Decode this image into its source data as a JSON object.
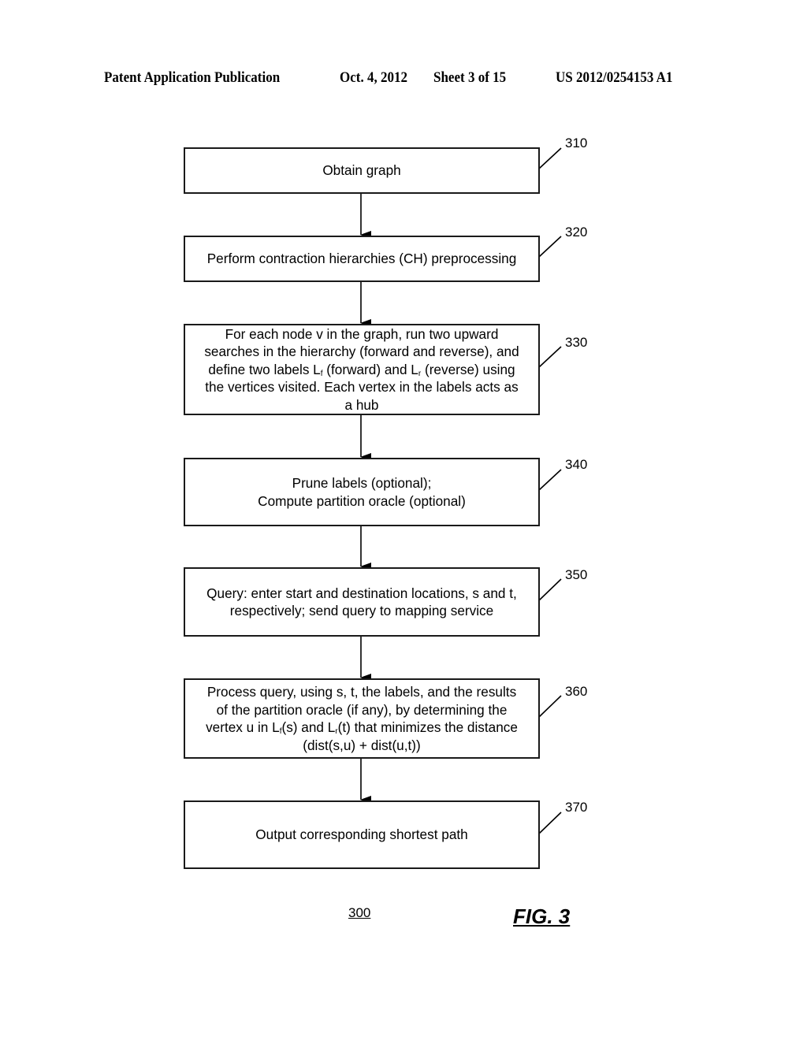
{
  "header": {
    "publication": "Patent Application Publication",
    "date": "Oct. 4, 2012",
    "sheet": "Sheet 3 of 15",
    "number": "US 2012/0254153 A1"
  },
  "flowchart": {
    "steps": [
      {
        "ref": "310",
        "text": "Obtain graph"
      },
      {
        "ref": "320",
        "text": "Perform contraction hierarchies (CH) preprocessing"
      },
      {
        "ref": "330",
        "line1": "For each node v in the graph, run two upward",
        "line2": "searches in the hierarchy (forward and reverse), and",
        "line3_a": "define two labels L",
        "line3_sub1": "f",
        "line3_b": " (forward) and L",
        "line3_sub2": "r",
        "line3_c": " (reverse) using",
        "line4": "the vertices visited.  Each vertex in the labels acts as",
        "line5": "a hub"
      },
      {
        "ref": "340",
        "line1": "Prune labels (optional);",
        "line2": "Compute partition oracle (optional)"
      },
      {
        "ref": "350",
        "line1": "Query: enter start and destination locations, s and t,",
        "line2": "respectively; send query to mapping service"
      },
      {
        "ref": "360",
        "line1": "Process query, using s, t, the labels, and the results",
        "line2": "of the partition oracle (if any), by determining the",
        "line3_a": "vertex u in L",
        "line3_sub1": "f",
        "line3_b": "(s) and L",
        "line3_sub2": "r",
        "line3_c": "(t) that minimizes the distance",
        "line4": "(dist(s,u) + dist(u,t))"
      },
      {
        "ref": "370",
        "text": "Output corresponding shortest path"
      }
    ]
  },
  "figure": {
    "number": "300",
    "label": "FIG. 3"
  }
}
